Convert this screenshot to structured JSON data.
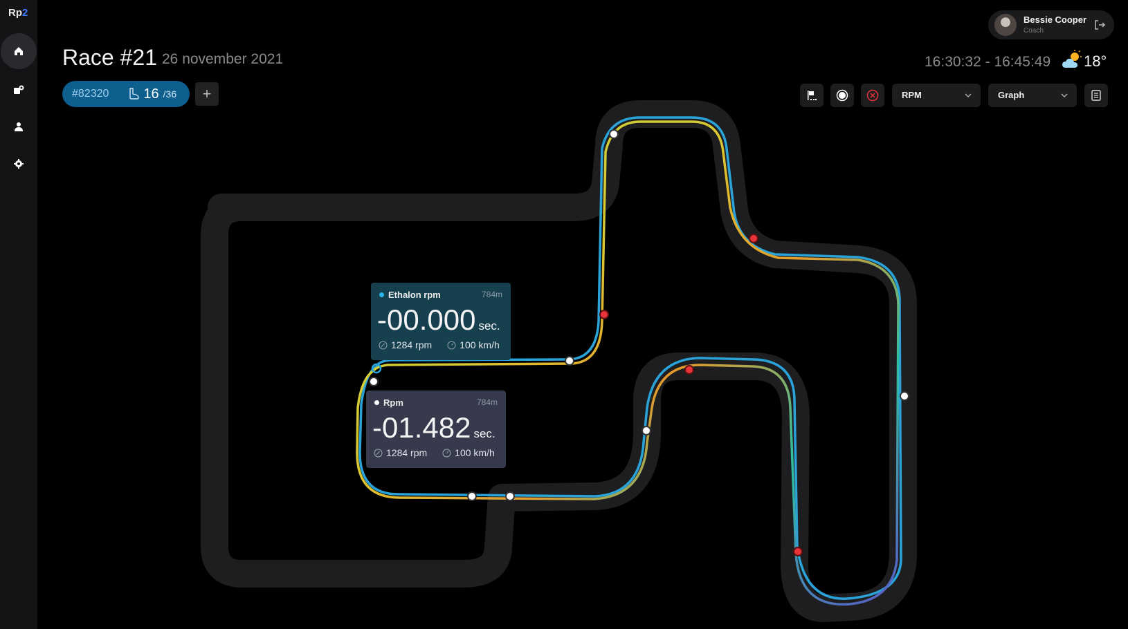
{
  "app": {
    "logo_main": "Rp",
    "logo_accent": "2"
  },
  "sidebar": {
    "items": [
      {
        "name": "home",
        "active": true
      },
      {
        "name": "races",
        "active": false
      },
      {
        "name": "profile",
        "active": false
      },
      {
        "name": "settings",
        "active": false
      }
    ]
  },
  "header": {
    "title": "Race #21",
    "date": "26 november 2021",
    "session_id": "#82320",
    "lap_current": "16",
    "lap_total": "/36",
    "add_label": "+",
    "time_range": "16:30:32 - 16:45:49",
    "temperature": "18°",
    "weather_icon": "partly-sunny-icon"
  },
  "user": {
    "name": "Bessie Cooper",
    "role": "Coach"
  },
  "toolbar": {
    "metric_select": "RPM",
    "view_select": "Graph"
  },
  "cards": [
    {
      "label": "Ethalon rpm",
      "distance": "784m",
      "time": "-00.000",
      "unit": "sec.",
      "rpm": "1284 rpm",
      "speed": "100 km/h",
      "dot_color": "#2eb6e8"
    },
    {
      "label": "Rpm",
      "distance": "784m",
      "time": "-01.482",
      "unit": "sec.",
      "rpm": "1284 rpm",
      "speed": "100 km/h",
      "dot_color": "#ffffff"
    }
  ],
  "colors": {
    "accent": "#0e5e8e",
    "ethalon_line": "#2aa3d9",
    "marker_alert": "#e8333a",
    "marker_default": "#ffffff"
  }
}
